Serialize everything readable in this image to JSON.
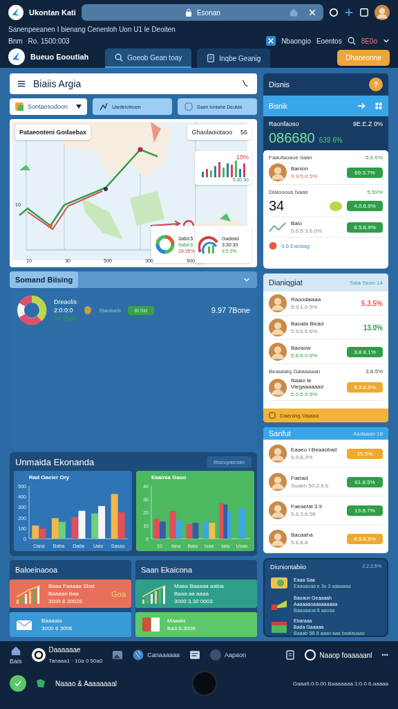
{
  "browser": {
    "app_name": "Ukontan Kati",
    "address": "Esonan"
  },
  "notice": "Sanenpeeanen I bienang Cenenloh Uon U1 le Deoiten",
  "account_bar": {
    "label": "Bnm",
    "value": "Ro. 1500:003",
    "links": [
      "Nbaongio",
      "Eoentos"
    ],
    "balance": "8E0o"
  },
  "nav": {
    "title": "Bueuo Eooutiah",
    "tabs": [
      {
        "label": "Goeob Gean toay",
        "selected": true
      },
      {
        "label": "Inqbe Geanig",
        "selected": false
      }
    ],
    "action": "Dhaneonne"
  },
  "header": {
    "title": "Biaiis Argia"
  },
  "filters": [
    {
      "kind": "select",
      "label": "Sontaesodoon"
    },
    {
      "kind": "chip",
      "label": "Uanfeiofeuen"
    },
    {
      "kind": "chip",
      "label": "Saan Ioniahe Deutas"
    }
  ],
  "map_card": {
    "title": "Pataeooteni Godaebax",
    "badge_label": "Ghaolaoiotaoo",
    "badge_value": "56",
    "y_label": "10",
    "x_labels": [
      "10",
      "30",
      "500",
      "300",
      "500"
    ],
    "bar_widget": {
      "value": "10%",
      "caption": "5:30:30"
    },
    "donut_widget": {
      "title": "3a6d:5",
      "line": "9a6d:6",
      "value": "28:35%"
    },
    "arc_widget": {
      "title": "Gadead",
      "line": "3:30:30",
      "value": "9:5.9%"
    }
  },
  "summary": {
    "title": "Somand Biising",
    "name": "Dreaolis",
    "sub": "2:0:0:0",
    "value": "53 7596",
    "tag": "Stauloeb",
    "chip": "Bi Sid",
    "total": "9.97 7Bone"
  },
  "economy": {
    "title": "Unmaida Ekonanda",
    "action": "Iliseuyaeoan",
    "charts": [
      {
        "chart_data": {
          "type": "bar",
          "title": "Rad Oaeler Ory",
          "categories": [
            "Cana",
            "Baba",
            "Dada",
            "Uaio",
            "Sasao"
          ],
          "ylim": [
            0,
            500
          ],
          "yticks": [
            0,
            100,
            200,
            300,
            400,
            500
          ],
          "series": [
            {
              "color": "#f0b84a",
              "values": [
                125,
                195,
                null,
                null,
                425
              ]
            },
            {
              "color": "#e0505a",
              "values": [
                95,
                null,
                205,
                null,
                250
              ]
            },
            {
              "color": "#6ccf7a",
              "values": [
                null,
                160,
                null,
                240,
                null
              ]
            },
            {
              "color": "#f4f6f8",
              "values": [
                null,
                null,
                265,
                310,
                null
              ]
            }
          ]
        }
      },
      {
        "chart_data": {
          "type": "bar",
          "title": "Eaainia Gaoo",
          "categories": [
            "10",
            "Iana",
            "Bata",
            "Ioaa",
            "Iata",
            "Uoao"
          ],
          "ylim": [
            0,
            40
          ],
          "yticks": [
            0,
            10,
            20,
            30,
            40
          ],
          "series": [
            {
              "color": "#e0505a",
              "values": [
                15,
                21,
                11,
                null,
                27,
                null
              ]
            },
            {
              "color": "#2f5fa8",
              "values": [
                13,
                null,
                12,
                null,
                26,
                null
              ]
            },
            {
              "color": "#3aa8e0",
              "values": [
                null,
                14,
                null,
                13,
                20,
                23
              ]
            },
            {
              "color": "#f0c050",
              "values": [
                null,
                null,
                null,
                12,
                null,
                null
              ]
            }
          ]
        }
      }
    ]
  },
  "lower_panels": [
    {
      "title": "Baloeinaooa",
      "cards": [
        {
          "title": "Baaa Faaaaa Sbat",
          "line2": "Baaaan Baa",
          "sub": "3000 8 30026",
          "side": "Goa",
          "color": "#e8705a"
        },
        {
          "title": "Baaaaia",
          "sub": "3000 6 3006",
          "color": "#3a9ad8"
        }
      ]
    },
    {
      "title": "Saan Ekaicona",
      "cards": [
        {
          "title": "Maaa Baaaaa aabia",
          "line2": "Baaa aa aaaa",
          "sub": "3000 3.30 0003",
          "color": "#2ea08a"
        },
        {
          "title": "Maaaia",
          "sub": "Ba3 6.3006",
          "color": "#5cc86a"
        }
      ]
    }
  ],
  "business_panel": {
    "title": "Disnis",
    "help": "?",
    "bar_title": "Bisnik",
    "stat_label": "Raonfaoso",
    "stat_change": "9E.E.Z 0%",
    "stat_value": "086680",
    "stat_delta": "639 6%",
    "rows": [
      {
        "kind": "heading",
        "label": "Faaufaoaoe daan",
        "value": "5.6.6%"
      },
      {
        "kind": "person",
        "name": "Banion",
        "sub": "9.9.5.0 5%",
        "badge": "69.3.7%",
        "color": "#2e9e48"
      },
      {
        "kind": "heading",
        "label": "Dialooous Naas",
        "value": "5.59%"
      },
      {
        "kind": "number",
        "value": "34",
        "badge": "4.0.6.9%",
        "color": "#2e9e48"
      },
      {
        "kind": "trend",
        "name": "Baio",
        "sub": "5.6.5 3.6.0%",
        "badge": "6.5.8.9%",
        "color": "#2e9e48"
      }
    ],
    "footer": "9.6 Eandag"
  },
  "activity_panel": {
    "title": "Dianiqgiat",
    "action": "Saia Sean 14",
    "rows": [
      {
        "kind": "value",
        "name": "Raoodaiaaa",
        "sub": "5.9.1.0 5%",
        "value": "5.3.5%",
        "color": "#e0604a"
      },
      {
        "kind": "value",
        "name": "Baoaia Bicad",
        "sub": "5.9.6.6 6%",
        "value": "13.0%",
        "color": "#2e9e48"
      },
      {
        "kind": "badge",
        "name": "Bazaow",
        "sub": "5.6.6.0 6%",
        "value": "3.8 8.1%",
        "color": "#2e9e48"
      },
      {
        "kind": "heading",
        "name": "Beaiaiaiq Gaiaaaaan",
        "value": "3.8.5%"
      },
      {
        "kind": "badge",
        "name": "Naaio Ie Viegaaaaaad",
        "sub": "5.0.5 0 5%",
        "value": "8.3.8.9%",
        "color": "#f0a830"
      }
    ],
    "footer": "Daening Vaiaaa"
  },
  "staff_panel": {
    "title": "Sanfut",
    "action": "Asdaaan 18",
    "rows": [
      {
        "name": "Eaaeo I Beaaobad",
        "sub": "5.9.8.3%",
        "value": "15.5%",
        "color": "#f0a830"
      },
      {
        "name": "Faeiad",
        "sub": "Suaen 50.2.6.6",
        "value": "61.8.5%",
        "color": "#2e9e48"
      },
      {
        "name": "Faeaefat 3.9",
        "sub": "5.6.3.6.56",
        "value": "13.8.7%",
        "color": "#2e9e48"
      },
      {
        "name": "Bacaaha",
        "sub": "5.8.8.8",
        "value": "6.5.8.9%",
        "color": "#f0a830"
      }
    ]
  },
  "news_panel": {
    "title": "Diuniontabiio",
    "value": "2.2.3.5%",
    "items": [
      {
        "title": "Eaaa Saa",
        "sub": "Eaaoaoaa e 3o 3 aaaaaaa"
      },
      {
        "title": "Baoaun Geaaaah",
        "line2": "Aaaaaaoaaaaaaaaa",
        "sub": "Baaoaaoa 8 aaoaa"
      },
      {
        "title": "Ebaraaa",
        "line2": "Bada Gaaaaa",
        "sub": "Baaab 5B 8 aaao aaa baatauaao"
      }
    ]
  },
  "bottom_bar": {
    "items": [
      {
        "kind": "home",
        "label": "Bais"
      },
      {
        "kind": "app",
        "label": "Daaaaaae",
        "sub": "Tanaaa1 · 10a 0 50a0"
      },
      {
        "kind": "image"
      },
      {
        "kind": "globe",
        "label": "Canaaaaaa"
      },
      {
        "kind": "doc"
      },
      {
        "kind": "circle",
        "label": "Aapaon"
      }
    ],
    "right_label": "Naaop foaaaaanl",
    "more": "•••",
    "user": "Naaao & Aaaaaaaal",
    "footer": "Gaaa9.0.0.00 Baaaaaaa 1:0.0 6.aaaaa"
  }
}
